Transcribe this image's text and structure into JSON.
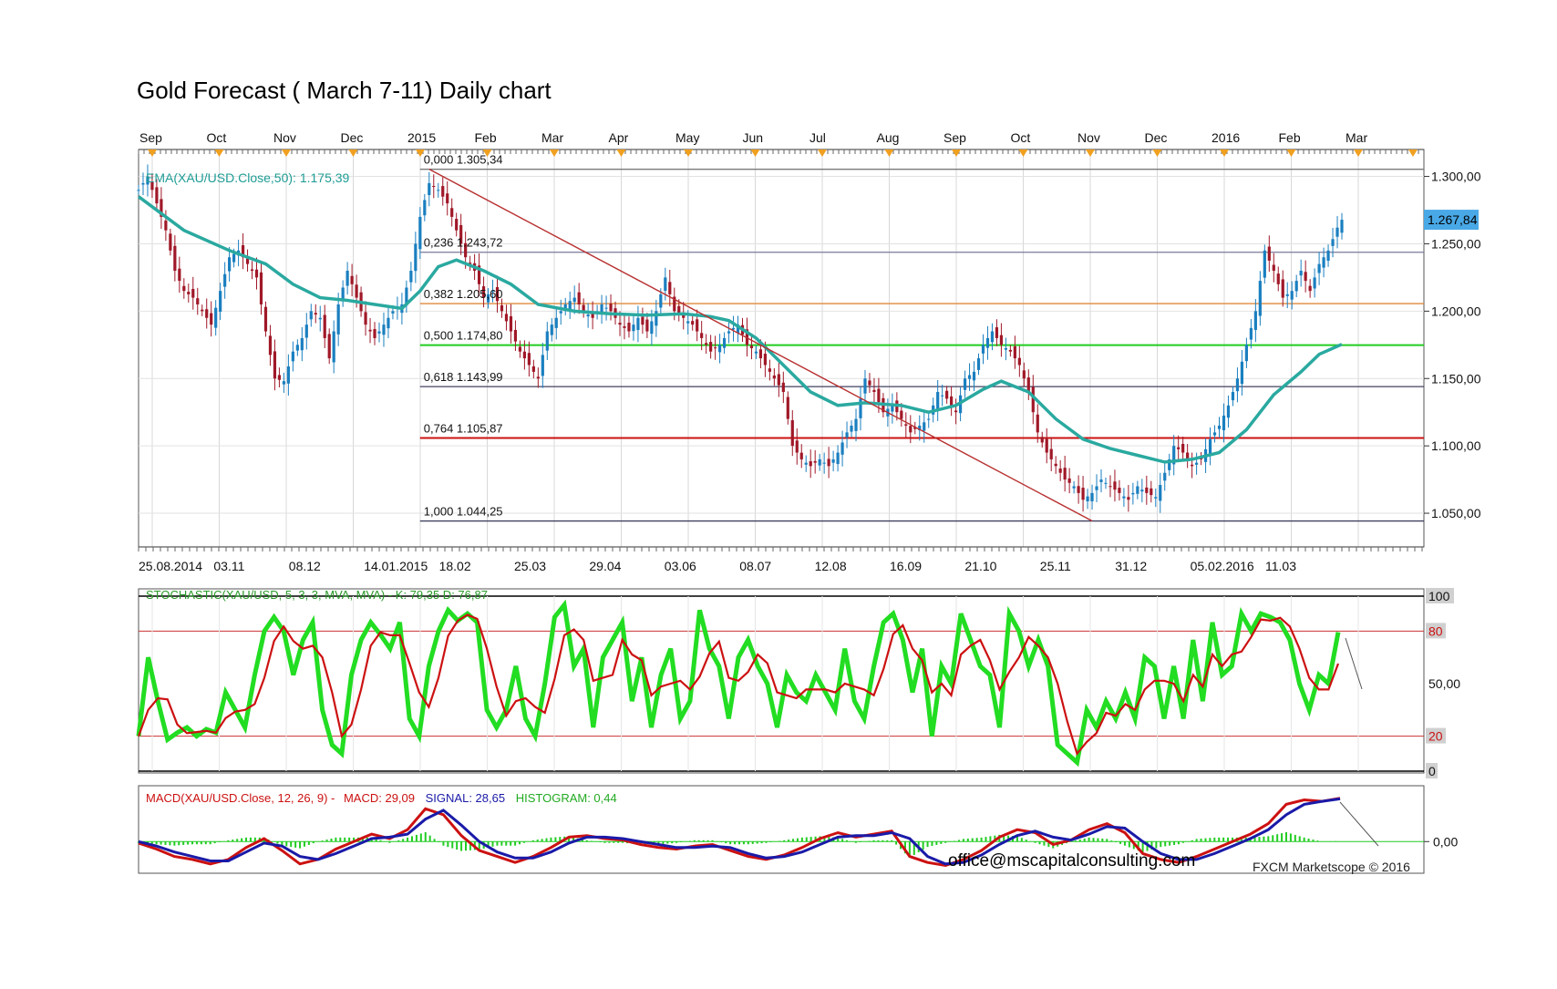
{
  "title": "Gold Forecast ( March 7-11) Daily chart",
  "colors": {
    "candle_up": "#1a7fc0",
    "candle_down": "#a01828",
    "ema": "#2aa9a0",
    "fib_0": "#7a7a7a",
    "fib_236": "#7a7a9a",
    "fib_382": "#e08a3c",
    "fib_500": "#22cc22",
    "fib_618": "#404060",
    "fib_764": "#cc1111",
    "fib_100": "#404060",
    "trendline": "#b83030",
    "stoch_k": "#22dd22",
    "stoch_d": "#cc1111",
    "macd_line": "#cc1111",
    "signal_line": "#1a1aa8",
    "histogram": "#22cc22",
    "price_box": "#49a8e6",
    "axis_marker": "#f0a020"
  },
  "chart_data": [
    {
      "type": "candlestick",
      "panel": "price",
      "title": "Gold Forecast ( March 7-11) Daily chart",
      "indicator_label": "EMA(XAU/USD.Close,50): 1.175,39",
      "current_price_label": "1.267,84",
      "current_price": 1267.84,
      "ylim": [
        1025,
        1320
      ],
      "y_ticks": [
        "1.300,00",
        "1.250,00",
        "1.200,00",
        "1.150,00",
        "1.100,00",
        "1.050,00"
      ],
      "y_tick_values": [
        1300,
        1250,
        1200,
        1150,
        1100,
        1050
      ],
      "x_month_labels": [
        "Sep",
        "Oct",
        "Nov",
        "Dec",
        "2015",
        "Feb",
        "Mar",
        "Apr",
        "May",
        "Jun",
        "Jul",
        "Aug",
        "Sep",
        "Oct",
        "Nov",
        "Dec",
        "2016",
        "Feb",
        "Mar"
      ],
      "x_date_labels": [
        "25.08.2014",
        "03.11",
        "08.12",
        "14.01.2015",
        "18.02",
        "25.03",
        "29.04",
        "03.06",
        "08.07",
        "12.08",
        "16.09",
        "21.10",
        "25.11",
        "31.12",
        "05.02.2016",
        "11.03"
      ],
      "fibonacci": [
        {
          "label": "0,000 1.305,34",
          "value": 1305.34
        },
        {
          "label": "0,236 1.243,72",
          "value": 1243.72
        },
        {
          "label": "0,382 1.205,60",
          "value": 1205.6
        },
        {
          "label": "0,500 1.174,80",
          "value": 1174.8
        },
        {
          "label": "0,618 1.143,99",
          "value": 1143.99
        },
        {
          "label": "0,764 1.105,87",
          "value": 1105.87
        },
        {
          "label": "1,000 1.044,25",
          "value": 1044.25
        }
      ],
      "price_path": [
        [
          0,
          1290
        ],
        [
          2,
          1300
        ],
        [
          4,
          1280
        ],
        [
          6,
          1260
        ],
        [
          8,
          1230
        ],
        [
          10,
          1215
        ],
        [
          12,
          1210
        ],
        [
          14,
          1200
        ],
        [
          16,
          1190
        ],
        [
          18,
          1215
        ],
        [
          20,
          1240
        ],
        [
          22,
          1245
        ],
        [
          24,
          1235
        ],
        [
          26,
          1225
        ],
        [
          28,
          1185
        ],
        [
          30,
          1150
        ],
        [
          32,
          1148
        ],
        [
          34,
          1170
        ],
        [
          36,
          1180
        ],
        [
          38,
          1200
        ],
        [
          40,
          1195
        ],
        [
          42,
          1165
        ],
        [
          44,
          1205
        ],
        [
          46,
          1230
        ],
        [
          48,
          1210
        ],
        [
          50,
          1190
        ],
        [
          52,
          1180
        ],
        [
          54,
          1190
        ],
        [
          56,
          1200
        ],
        [
          58,
          1205
        ],
        [
          60,
          1230
        ],
        [
          62,
          1270
        ],
        [
          64,
          1295
        ],
        [
          66,
          1290
        ],
        [
          68,
          1280
        ],
        [
          70,
          1260
        ],
        [
          72,
          1240
        ],
        [
          74,
          1230
        ],
        [
          76,
          1210
        ],
        [
          78,
          1215
        ],
        [
          80,
          1200
        ],
        [
          82,
          1185
        ],
        [
          84,
          1170
        ],
        [
          86,
          1160
        ],
        [
          88,
          1150
        ],
        [
          90,
          1185
        ],
        [
          92,
          1195
        ],
        [
          94,
          1205
        ],
        [
          96,
          1210
        ],
        [
          98,
          1200
        ],
        [
          100,
          1195
        ],
        [
          102,
          1205
        ],
        [
          104,
          1200
        ],
        [
          106,
          1190
        ],
        [
          108,
          1185
        ],
        [
          110,
          1195
        ],
        [
          112,
          1185
        ],
        [
          114,
          1200
        ],
        [
          116,
          1225
        ],
        [
          118,
          1200
        ],
        [
          120,
          1195
        ],
        [
          122,
          1190
        ],
        [
          124,
          1180
        ],
        [
          126,
          1170
        ],
        [
          128,
          1175
        ],
        [
          130,
          1185
        ],
        [
          132,
          1190
        ],
        [
          134,
          1175
        ],
        [
          136,
          1170
        ],
        [
          138,
          1160
        ],
        [
          140,
          1150
        ],
        [
          142,
          1140
        ],
        [
          144,
          1100
        ],
        [
          146,
          1090
        ],
        [
          148,
          1085
        ],
        [
          150,
          1090
        ],
        [
          152,
          1085
        ],
        [
          154,
          1095
        ],
        [
          156,
          1110
        ],
        [
          158,
          1120
        ],
        [
          160,
          1150
        ],
        [
          162,
          1140
        ],
        [
          164,
          1125
        ],
        [
          166,
          1130
        ],
        [
          168,
          1120
        ],
        [
          170,
          1110
        ],
        [
          172,
          1115
        ],
        [
          174,
          1120
        ],
        [
          176,
          1140
        ],
        [
          178,
          1135
        ],
        [
          180,
          1125
        ],
        [
          182,
          1150
        ],
        [
          184,
          1155
        ],
        [
          186,
          1175
        ],
        [
          188,
          1185
        ],
        [
          190,
          1175
        ],
        [
          192,
          1170
        ],
        [
          194,
          1160
        ],
        [
          196,
          1140
        ],
        [
          198,
          1110
        ],
        [
          200,
          1095
        ],
        [
          202,
          1085
        ],
        [
          204,
          1075
        ],
        [
          206,
          1070
        ],
        [
          208,
          1060
        ],
        [
          210,
          1065
        ],
        [
          212,
          1075
        ],
        [
          214,
          1070
        ],
        [
          216,
          1065
        ],
        [
          218,
          1060
        ],
        [
          220,
          1070
        ],
        [
          222,
          1065
        ],
        [
          224,
          1062
        ],
        [
          226,
          1080
        ],
        [
          228,
          1100
        ],
        [
          230,
          1095
        ],
        [
          232,
          1085
        ],
        [
          234,
          1090
        ],
        [
          236,
          1105
        ],
        [
          238,
          1115
        ],
        [
          240,
          1130
        ],
        [
          242,
          1150
        ],
        [
          244,
          1175
        ],
        [
          246,
          1200
        ],
        [
          248,
          1245
        ],
        [
          250,
          1230
        ],
        [
          252,
          1210
        ],
        [
          254,
          1215
        ],
        [
          256,
          1230
        ],
        [
          258,
          1215
        ],
        [
          260,
          1235
        ],
        [
          262,
          1245
        ],
        [
          264,
          1262
        ],
        [
          265,
          1267.84
        ]
      ],
      "ema_path": [
        [
          0,
          1285
        ],
        [
          10,
          1260
        ],
        [
          20,
          1245
        ],
        [
          28,
          1235
        ],
        [
          34,
          1220
        ],
        [
          40,
          1210
        ],
        [
          46,
          1208
        ],
        [
          52,
          1205
        ],
        [
          58,
          1202
        ],
        [
          62,
          1215
        ],
        [
          66,
          1233
        ],
        [
          70,
          1238
        ],
        [
          76,
          1230
        ],
        [
          82,
          1220
        ],
        [
          88,
          1205
        ],
        [
          96,
          1200
        ],
        [
          104,
          1198
        ],
        [
          112,
          1197
        ],
        [
          120,
          1198
        ],
        [
          126,
          1196
        ],
        [
          130,
          1193
        ],
        [
          136,
          1180
        ],
        [
          142,
          1160
        ],
        [
          148,
          1140
        ],
        [
          154,
          1130
        ],
        [
          160,
          1132
        ],
        [
          168,
          1130
        ],
        [
          174,
          1125
        ],
        [
          180,
          1130
        ],
        [
          186,
          1142
        ],
        [
          190,
          1148
        ],
        [
          196,
          1140
        ],
        [
          202,
          1120
        ],
        [
          208,
          1105
        ],
        [
          214,
          1098
        ],
        [
          220,
          1093
        ],
        [
          226,
          1088
        ],
        [
          232,
          1090
        ],
        [
          238,
          1095
        ],
        [
          244,
          1112
        ],
        [
          250,
          1138
        ],
        [
          256,
          1155
        ],
        [
          260,
          1168
        ],
        [
          265,
          1175.39
        ]
      ],
      "trendline": {
        "from": [
          64,
          1305.34
        ],
        "to": [
          210,
          1044.25
        ]
      }
    },
    {
      "type": "line",
      "panel": "stochastic",
      "indicator_label": "STOCHASTIC(XAU/USD, 5, 3, 3, MVA, MVA) - K: 79,35 D: 76,87",
      "ylim": [
        0,
        100
      ],
      "y_ticks": [
        "100",
        "80",
        "50,00",
        "20",
        "0"
      ],
      "y_tick_values": [
        100,
        80,
        50,
        20,
        0
      ],
      "series": [
        {
          "values": [
            20,
            65,
            40,
            18,
            22,
            25,
            20,
            24,
            22,
            45,
            35,
            25,
            55,
            80,
            88,
            80,
            55,
            75,
            85,
            35,
            15,
            10,
            55,
            75,
            85,
            78,
            70,
            85,
            30,
            20,
            60,
            80,
            92,
            86,
            90,
            85,
            35,
            25,
            35,
            60,
            30,
            20,
            50,
            88,
            95,
            60,
            70,
            25,
            65,
            75,
            85,
            40,
            65,
            25,
            55,
            70,
            30,
            40,
            92,
            70,
            60,
            30,
            65,
            75,
            60,
            50,
            25,
            55,
            45,
            40,
            55,
            45,
            35,
            70,
            40,
            30,
            60,
            85,
            90,
            75,
            45,
            70,
            20,
            60,
            50,
            90,
            75,
            60,
            55,
            25,
            90,
            80,
            60,
            75,
            60,
            15,
            10,
            5,
            35,
            25,
            40,
            30,
            45,
            30,
            65,
            60,
            30,
            60,
            30,
            75,
            40,
            85,
            55,
            60,
            90,
            80,
            90,
            88,
            85,
            75,
            50,
            35,
            55,
            50,
            79.35
          ]
        }
      ]
    },
    {
      "type": "line",
      "panel": "macd",
      "indicator_label": "MACD(XAU/USD.Close, 12, 26, 9) - MACD: 29,09 SIGNAL: 28,65 HISTOGRAM: 0,44",
      "macd_text": "MACD(XAU/USD.Close, 12, 26, 9) -",
      "macd_value_text": "MACD: 29,09",
      "signal_value_text": "SIGNAL: 28,65",
      "histogram_value_text": "HISTOGRAM: 0,44",
      "y_ticks": [
        "0,00"
      ],
      "y_tick_values": [
        0
      ],
      "ylim": [
        -20,
        35
      ],
      "series": [
        {
          "name": "MACD",
          "values": [
            -1,
            -5,
            -10,
            -12,
            -15,
            -12,
            -4,
            2,
            -6,
            -15,
            -12,
            -5,
            0,
            5,
            2,
            8,
            22,
            18,
            4,
            -6,
            -10,
            -14,
            -10,
            -4,
            3,
            4,
            2,
            1,
            -2,
            -4,
            -5,
            -3,
            -2,
            -6,
            -10,
            -12,
            -9,
            -4,
            2,
            6,
            3,
            5,
            7,
            -10,
            -14,
            -16,
            -12,
            -6,
            3,
            8,
            6,
            -2,
            1,
            8,
            12,
            6,
            -8,
            -12,
            -14,
            -10,
            -5,
            0,
            5,
            12,
            25,
            28,
            27,
            29.09
          ]
        },
        {
          "name": "SIGNAL",
          "values": [
            0,
            -3,
            -7,
            -10,
            -13,
            -13,
            -7,
            -1,
            -3,
            -10,
            -12,
            -8,
            -3,
            2,
            3,
            5,
            15,
            21,
            11,
            0,
            -7,
            -11,
            -11,
            -7,
            -1,
            3,
            3,
            2,
            0,
            -2,
            -4,
            -4,
            -3,
            -4,
            -8,
            -11,
            -10,
            -7,
            -2,
            3,
            4,
            4,
            6,
            2,
            -10,
            -15,
            -14,
            -9,
            -2,
            4,
            7,
            3,
            1,
            5,
            10,
            9,
            0,
            -8,
            -12,
            -12,
            -8,
            -3,
            2,
            8,
            18,
            25,
            27,
            28.65
          ]
        }
      ]
    }
  ],
  "watermark": "office@mscapitalconsulting.com",
  "footer_credit": "FXCM Marketscope © 2016"
}
